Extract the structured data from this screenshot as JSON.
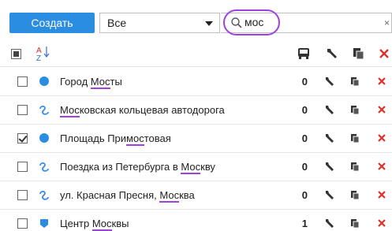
{
  "toolbar": {
    "create_label": "Создать",
    "filter_value": "Все",
    "search_value": "мос"
  },
  "header": {
    "sort_icon": "sort-alpha-icon",
    "columns": [
      "transport-icon",
      "wrench-icon",
      "copy-icon",
      "delete-icon"
    ]
  },
  "rows": [
    {
      "prefix": "Город ",
      "match": "Мос",
      "suffix": "ты",
      "count": "0",
      "type": "point",
      "checked": false
    },
    {
      "prefix": "",
      "match": "Мос",
      "suffix": "ковская кольцевая автодорога",
      "count": "0",
      "type": "route",
      "checked": false
    },
    {
      "prefix": "Площадь При",
      "match": "мос",
      "suffix": "товая",
      "count": "0",
      "type": "point",
      "checked": true
    },
    {
      "prefix": "Поездка из Петербурга в ",
      "match": "Мос",
      "suffix": "кву",
      "count": "0",
      "type": "route",
      "checked": false
    },
    {
      "prefix": "ул. Красная Пресня, ",
      "match": "Мос",
      "suffix": "ква",
      "count": "0",
      "type": "route",
      "checked": false
    },
    {
      "prefix": "Центр ",
      "match": "Мос",
      "suffix": "квы",
      "count": "1",
      "type": "area",
      "checked": false
    }
  ],
  "colors": {
    "accent": "#2a8de0",
    "highlight": "#a040e0",
    "delete": "#e0302a",
    "route": "#3a8de0"
  }
}
